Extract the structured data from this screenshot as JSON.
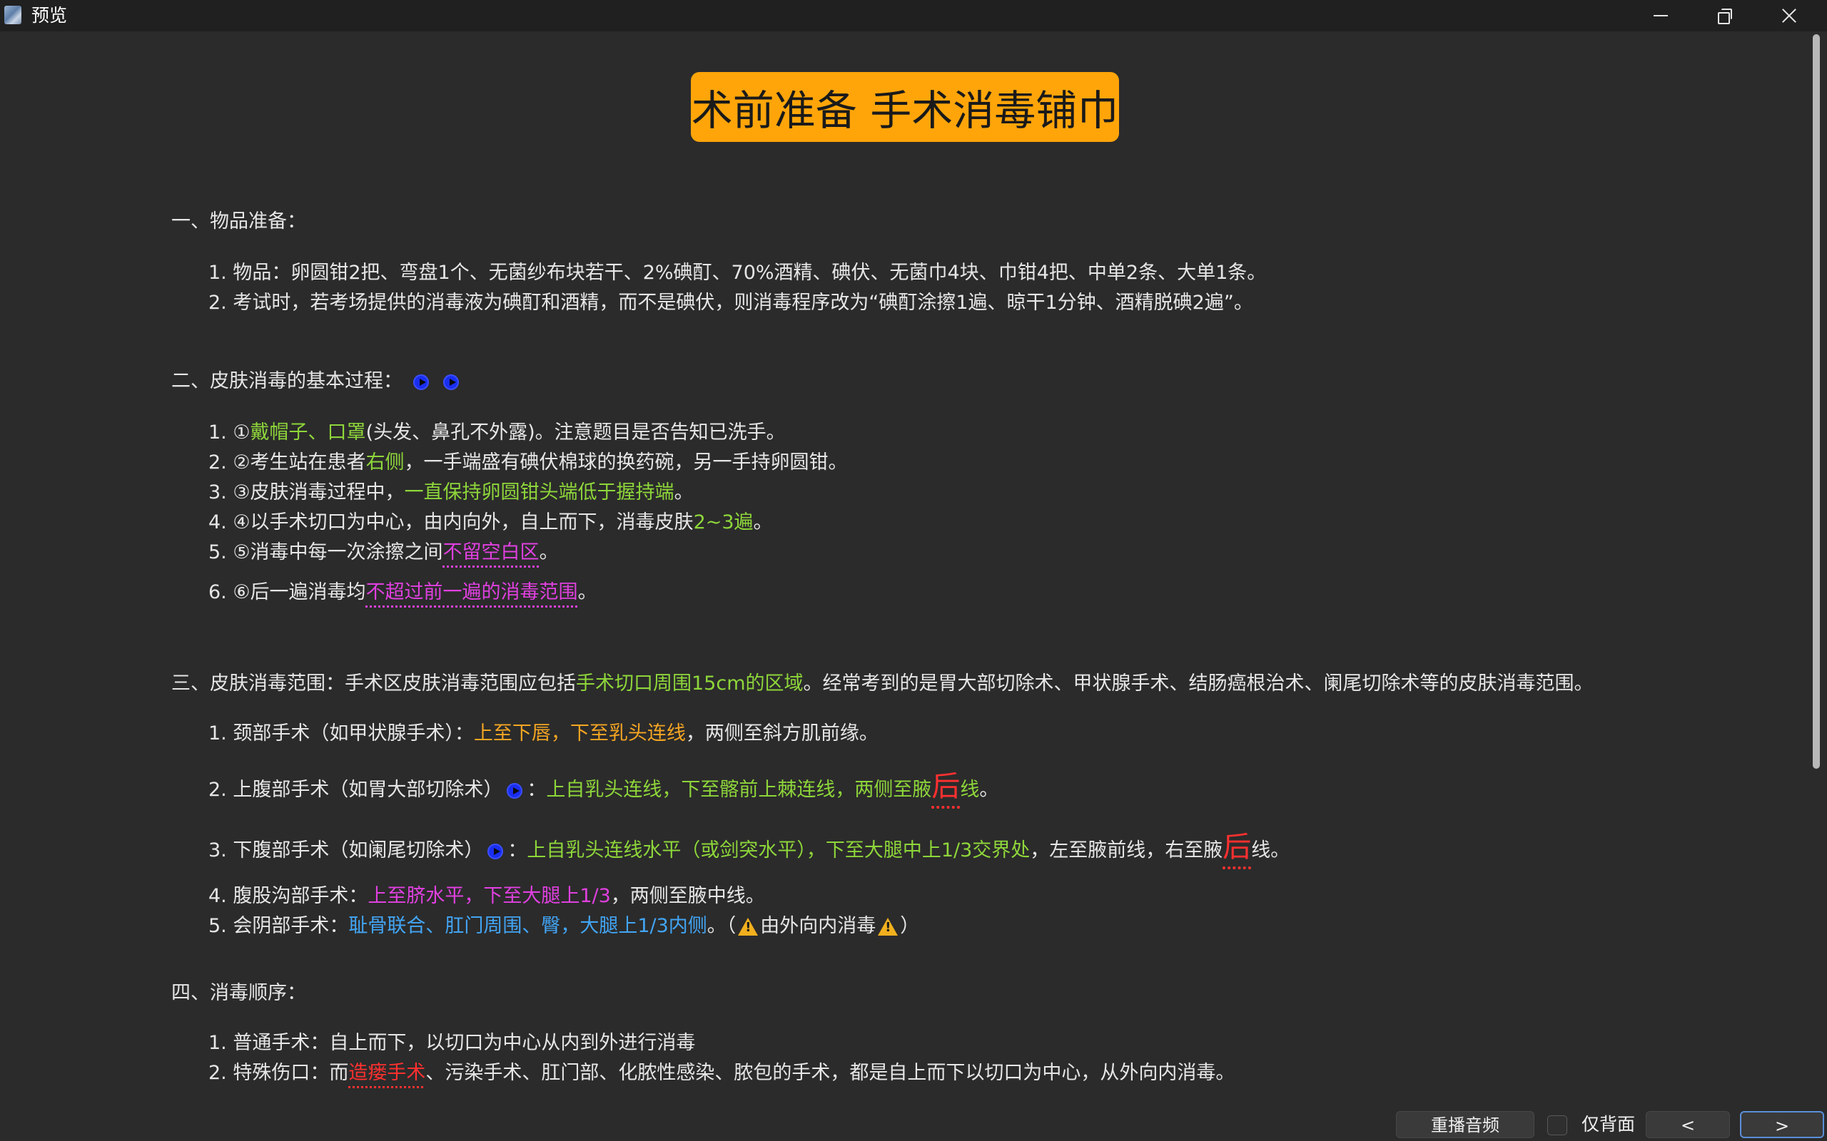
{
  "window": {
    "title": "预览"
  },
  "page": {
    "title": "术前准备 手术消毒铺巾"
  },
  "s1": {
    "heading": "一、物品准备：",
    "i1": "1. 物品：卵圆钳2把、弯盘1个、无菌纱布块若干、2%碘酊、70%酒精、碘伏、无菌巾4块、巾钳4把、中单2条、大单1条。",
    "i2": "2. 考试时，若考场提供的消毒液为碘酊和酒精，而不是碘伏，则消毒程序改为“碘酊涂擦1遍、晾干1分钟、酒精脱碘2遍”。"
  },
  "s2": {
    "heading": "二、皮肤消毒的基本过程：",
    "i1": {
      "a": "1. ①",
      "b": "戴帽子、口罩",
      "c": "(头发、鼻孔不外露)。注意题目是否告知已洗手。"
    },
    "i2": {
      "a": "2. ②考生站在患者",
      "b": "右侧",
      "c": "，一手端盛有碘伏棉球的换药碗，另一手持卵圆钳。"
    },
    "i3": {
      "a": "3. ③皮肤消毒过程中，",
      "b": "一直保持卵圆钳头端低于握持端",
      "c": "。"
    },
    "i4": {
      "a": "4. ④以手术切口为中心，由内向外，自上而下，消毒皮肤",
      "b": "2~3遍",
      "c": "。"
    },
    "i5": {
      "a": "5. ⑤消毒中每一次涂擦之间",
      "b": "不留空白区",
      "c": "。"
    },
    "i6": {
      "a": "6. ⑥后一遍消毒均",
      "b": "不超过前一遍的消毒范围",
      "c": "。"
    }
  },
  "s3": {
    "heading": {
      "a": "三、皮肤消毒范围：手术区皮肤消毒范围应包括",
      "b": "手术切口周围15cm的区域",
      "c": "。经常考到的是胃大部切除术、甲状腺手术、结肠癌根治术、阑尾切除术等的皮肤消毒范围。"
    },
    "i1": {
      "a": "1. 颈部手术（如甲状腺手术）：",
      "b": "上至下唇，下至乳头连线",
      "c": "，两侧至斜方肌前缘。"
    },
    "i2": {
      "a": "2. 上腹部手术（如胃大部切除术）",
      "a2": "：",
      "b": "上自乳头连线，下至髂前上棘连线，两侧至腋",
      "c": "后",
      "d": "线",
      "e": "。"
    },
    "i3": {
      "a": "3. 下腹部手术（如阑尾切除术）",
      "a2": "：",
      "b": "上自乳头连线水平（或剑突水平），下至大腿中上1/3交界处",
      "c": "，左至腋前线，右至腋",
      "d": "后",
      "e": "线。"
    },
    "i4": {
      "a": "4. 腹股沟部手术：",
      "b": "上至脐水平，下至大腿上1/3",
      "c": "，两侧至腋中线。"
    },
    "i5": {
      "a": "5. 会阴部手术：",
      "b": "耻骨联合、肛门周围、臀，大腿上1/3内侧",
      "c": "。（",
      "d": "由外向内消毒",
      "e": "）"
    }
  },
  "s4": {
    "heading": "四、消毒顺序：",
    "i1": "1. 普通手术：自上而下，以切口为中心从内到外进行消毒",
    "i2": {
      "a": "2. 特殊伤口：而",
      "b": "造瘘手术",
      "c": "、污染手术、肛门部、化脓性感染、脓包的手术，都是自上而下以切口为中心，从外向内消毒。"
    }
  },
  "controls": {
    "replay": "重播音频",
    "back_only": "仅背面",
    "prev": "<",
    "next": ">"
  },
  "colors": {
    "title_bg": "#ffa50a",
    "green": "#8ed63a",
    "orange": "#f5a623",
    "magenta": "#e040e0",
    "blue": "#42a5f5",
    "red": "#ff3030"
  }
}
